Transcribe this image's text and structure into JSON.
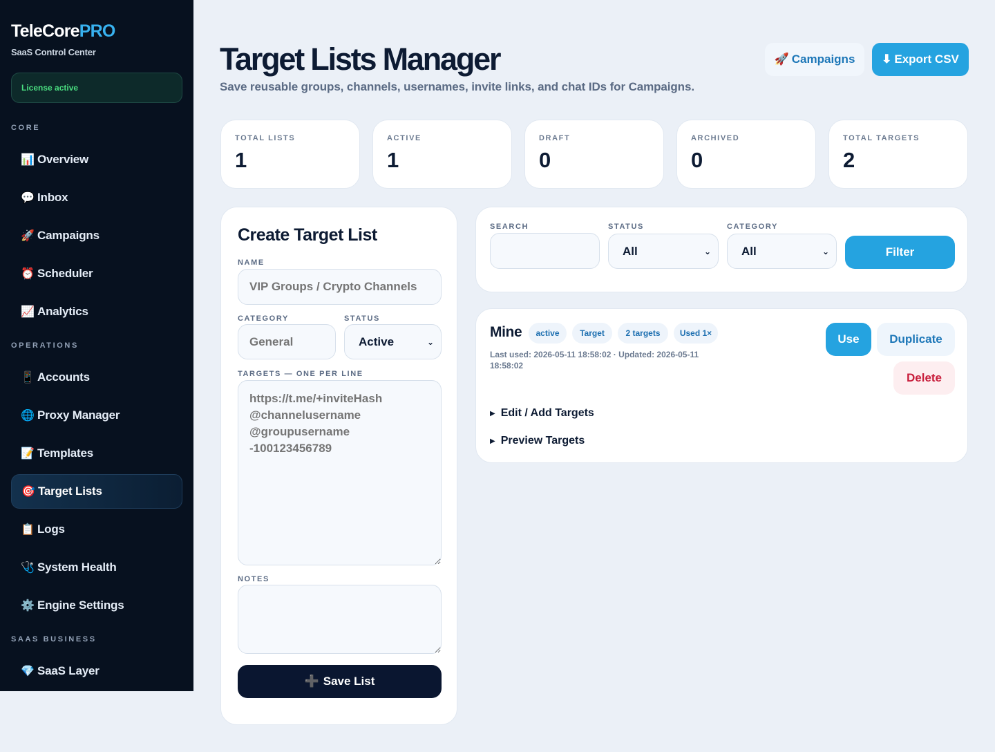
{
  "brand": {
    "name": "TeleCore",
    "suffix": "PRO",
    "subtitle": "SaaS Control Center"
  },
  "license": "License active",
  "sidebar": {
    "sections": [
      {
        "label": "CORE",
        "items": [
          {
            "icon": "📊",
            "label": "Overview"
          },
          {
            "icon": "💬",
            "label": "Inbox"
          },
          {
            "icon": "🚀",
            "label": "Campaigns"
          },
          {
            "icon": "⏰",
            "label": "Scheduler"
          },
          {
            "icon": "📈",
            "label": "Analytics"
          }
        ]
      },
      {
        "label": "OPERATIONS",
        "items": [
          {
            "icon": "📱",
            "label": "Accounts"
          },
          {
            "icon": "🌐",
            "label": "Proxy Manager"
          },
          {
            "icon": "📝",
            "label": "Templates"
          },
          {
            "icon": "🎯",
            "label": "Target Lists",
            "active": true
          },
          {
            "icon": "📋",
            "label": "Logs"
          },
          {
            "icon": "🩺",
            "label": "System Health"
          },
          {
            "icon": "⚙️",
            "label": "Engine Settings"
          }
        ]
      },
      {
        "label": "SAAS BUSINESS",
        "items": [
          {
            "icon": "💎",
            "label": "SaaS Layer"
          }
        ]
      }
    ]
  },
  "header": {
    "title": "Target Lists Manager",
    "subtitle": "Save reusable groups, channels, usernames, invite links, and chat IDs for Campaigns.",
    "campaigns_icon": "🚀",
    "campaigns_label": "Campaigns",
    "export_icon": "⬇",
    "export_label": "Export CSV"
  },
  "stats": [
    {
      "label": "TOTAL LISTS",
      "value": "1"
    },
    {
      "label": "ACTIVE",
      "value": "1"
    },
    {
      "label": "DRAFT",
      "value": "0"
    },
    {
      "label": "ARCHIVED",
      "value": "0"
    },
    {
      "label": "TOTAL TARGETS",
      "value": "2"
    }
  ],
  "create": {
    "title": "Create Target List",
    "name_label": "NAME",
    "name_placeholder": "VIP Groups / Crypto Channels",
    "category_label": "CATEGORY",
    "category_placeholder": "General",
    "status_label": "STATUS",
    "status_value": "Active",
    "targets_label": "TARGETS — ONE PER LINE",
    "targets_placeholder": "https://t.me/+inviteHash\n@channelusername\n@groupusername\n-100123456789",
    "notes_label": "NOTES",
    "save_icon": "➕",
    "save_label": "Save List"
  },
  "filter": {
    "search_label": "SEARCH",
    "status_label": "STATUS",
    "status_value": "All",
    "category_label": "CATEGORY",
    "category_value": "All",
    "button": "Filter"
  },
  "list_item": {
    "name": "Mine",
    "badges": [
      "active",
      "Target",
      "2 targets",
      "Used 1×"
    ],
    "meta": "Last used: 2026-05-11 18:58:02 · Updated: 2026-05-11 18:58:02",
    "use": "Use",
    "duplicate": "Duplicate",
    "delete": "Delete",
    "edit": "Edit / Add Targets",
    "preview": "Preview Targets"
  }
}
